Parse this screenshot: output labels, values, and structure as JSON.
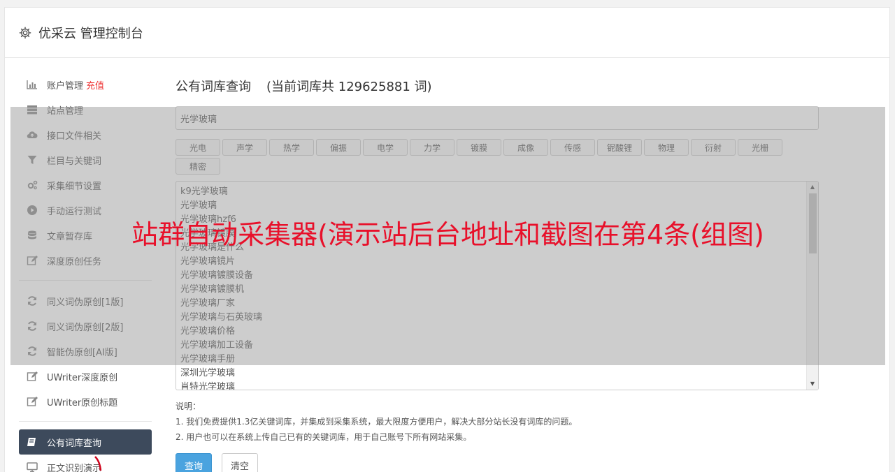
{
  "header": {
    "title": "优采云 管理控制台",
    "icon": "gear-icon"
  },
  "sidebar": {
    "items": [
      {
        "label": "账户管理",
        "extra": "充值",
        "icon": "bar-chart-icon"
      },
      {
        "label": "站点管理",
        "icon": "server-icon"
      },
      {
        "label": "接口文件相关",
        "icon": "cloud-upload-icon"
      },
      {
        "label": "栏目与关键词",
        "icon": "filter-icon"
      },
      {
        "label": "采集细节设置",
        "icon": "cogs-icon"
      },
      {
        "label": "手动运行测试",
        "icon": "play-circle-icon"
      },
      {
        "label": "文章暂存库",
        "icon": "database-icon"
      },
      {
        "label": "深度原创任务",
        "icon": "edit-icon"
      },
      {
        "label": "同义词伪原创[1版]",
        "icon": "refresh-icon"
      },
      {
        "label": "同义词伪原创[2版]",
        "icon": "refresh-icon"
      },
      {
        "label": "智能伪原创[AI版]",
        "icon": "refresh-icon"
      },
      {
        "label": "UWriter深度原创",
        "icon": "edit-icon"
      },
      {
        "label": "UWriter原创标题",
        "icon": "edit-icon"
      },
      {
        "label": "公有词库查询",
        "icon": "book-icon"
      },
      {
        "label": "正文识别演示",
        "icon": "monitor-icon"
      }
    ]
  },
  "main": {
    "title": "公有词库查询",
    "count_text": "(当前词库共 129625881 词)",
    "search_value": "光学玻璃",
    "tags": [
      "光电",
      "声学",
      "热学",
      "偏振",
      "电学",
      "力学",
      "镀膜",
      "成像",
      "传感",
      "铌酸锂",
      "物理",
      "衍射",
      "光栅",
      "精密"
    ],
    "words": [
      "k9光学玻璃",
      "光学玻璃",
      "光学玻璃hzf6",
      "光学玻璃镀膜",
      "光学玻璃是什么",
      "光学玻璃镜片",
      "光学玻璃镀膜设备",
      "光学玻璃镀膜机",
      "光学玻璃厂家",
      "光学玻璃与石英玻璃",
      "光学玻璃价格",
      "光学玻璃加工设备",
      "光学玻璃手册",
      "深圳光学玻璃",
      "肖特光学玻璃"
    ],
    "notes_title": "说明：",
    "notes": [
      "1. 我们免费提供1.3亿关键词库，并集成到采集系统，最大限度方便用户，解决大部分站长没有词库的问题。",
      "2. 用户也可以在系统上传自己已有的关键词库，用于自己账号下所有网站采集。"
    ],
    "query_button": "查询",
    "clear_button": "清空"
  },
  "overlay": {
    "text": "站群自动采集器(演示站后台地址和截图在第4条(组图)"
  },
  "colors": {
    "active_nav": "#3d4a5c",
    "primary": "#4aa3df",
    "overlay_text": "#e8102a",
    "recharge": "#ee3333"
  }
}
